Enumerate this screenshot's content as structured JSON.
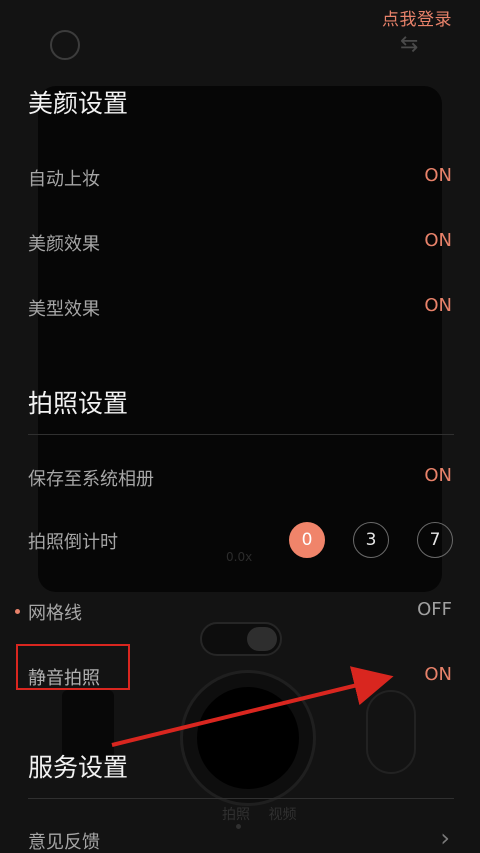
{
  "header": {
    "login_link": "点我登录"
  },
  "sections": {
    "beauty": {
      "title": "美颜设置",
      "items": [
        {
          "label": "自动上妆",
          "value": "ON"
        },
        {
          "label": "美颜效果",
          "value": "ON"
        },
        {
          "label": "美型效果",
          "value": "ON"
        }
      ]
    },
    "photo": {
      "title": "拍照设置",
      "save_to_album": {
        "label": "保存至系统相册",
        "value": "ON"
      },
      "countdown": {
        "label": "拍照倒计时",
        "options": [
          "0",
          "3",
          "7"
        ],
        "selected": "0"
      },
      "grid": {
        "label": "网格线",
        "value": "OFF"
      },
      "mute": {
        "label": "静音拍照",
        "value": "ON"
      }
    },
    "service": {
      "title": "服务设置",
      "items": [
        {
          "label": "意见反馈"
        }
      ]
    }
  },
  "background": {
    "zoom_text": "0.0x",
    "modes": [
      "拍照",
      "视频"
    ]
  },
  "colors": {
    "accent": "#e8826a",
    "annotation": "#d9261f"
  },
  "icons": {
    "switch_camera": "switch-camera-icon",
    "feedback_arrow": "chevron-right-icon"
  }
}
